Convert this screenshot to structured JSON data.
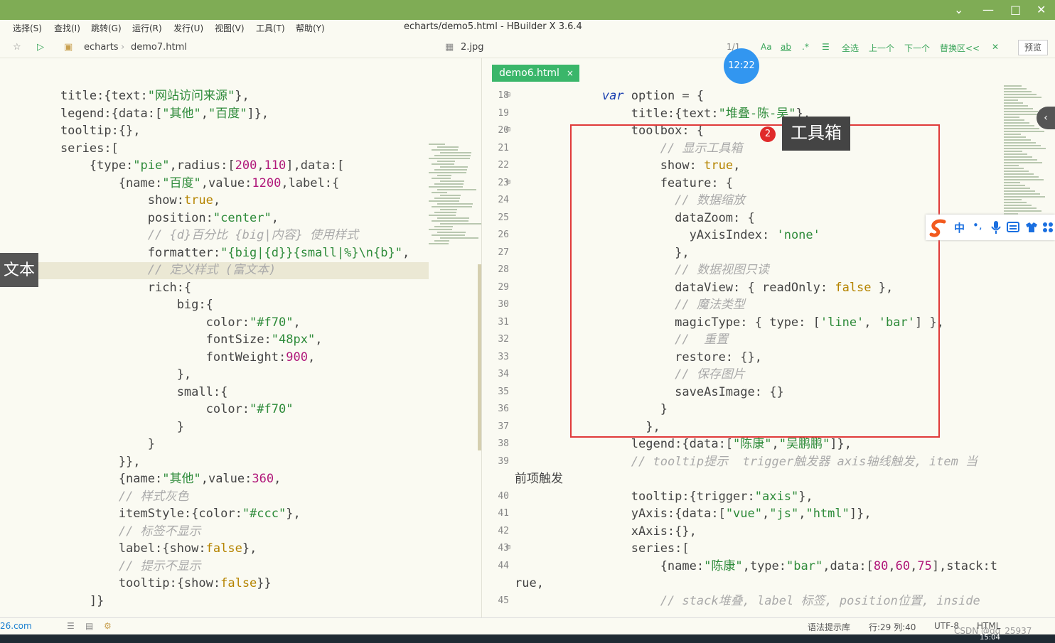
{
  "window": {
    "title": "echarts/demo5.html - HBuilder X 3.6.4"
  },
  "menu": [
    "选择(S)",
    "查找(I)",
    "跳转(G)",
    "运行(R)",
    "发行(U)",
    "视图(V)",
    "工具(T)",
    "帮助(Y)"
  ],
  "toolbar": {
    "breadcrumb": [
      "echarts",
      "demo7.html"
    ],
    "image_file": "2.jpg",
    "find_count": "1/1",
    "match_case": "Aa",
    "whole_word": "ab",
    "select_all": "全选",
    "prev": "上一个",
    "next": "下一个",
    "replace": "替换区<<",
    "preview": "预览"
  },
  "clock": "12:22",
  "tab": {
    "label": "demo6.html",
    "close": "×"
  },
  "annotation": {
    "badge": "2",
    "label": "工具箱",
    "left_tooltip": "文本"
  },
  "left_code": [
    "    title:{text:\"网站访问来源\"},",
    "    legend:{data:[\"其他\",\"百度\"]},",
    "    tooltip:{},",
    "    series:[",
    "        {type:\"pie\",radius:[200,110],data:[",
    "            {name:\"百度\",value:1200,label:{",
    "                show:true,",
    "                position:\"center\",",
    "                // {d}百分比 {big|内容} 使用样式",
    "                formatter:\"{big|{d}}{small|%}\\n{b}\",",
    "                // 定义样式 (富文本)",
    "                rich:{",
    "                    big:{",
    "                        color:\"#f70\",",
    "                        fontSize:\"48px\",",
    "                        fontWeight:900,",
    "                    },",
    "                    small:{",
    "                        color:\"#f70\"",
    "                    }",
    "                }",
    "            }},",
    "            {name:\"其他\",value:360,",
    "            // 样式灰色",
    "            itemStyle:{color:\"#ccc\"},",
    "            // 标签不显示",
    "            label:{show:false},",
    "            // 提示不显示",
    "            tooltip:{show:false}}",
    "        ]}"
  ],
  "right_code": [
    {
      "n": "18",
      "t": "            var option = {"
    },
    {
      "n": "19",
      "t": "                title:{text:\"堆叠-陈-吴\"},"
    },
    {
      "n": "20",
      "t": "                toolbox: {"
    },
    {
      "n": "21",
      "t": "                    // 显示工具箱"
    },
    {
      "n": "22",
      "t": "                    show: true,"
    },
    {
      "n": "23",
      "t": "                    feature: {"
    },
    {
      "n": "24",
      "t": "                      // 数据缩放"
    },
    {
      "n": "25",
      "t": "                      dataZoom: {"
    },
    {
      "n": "26",
      "t": "                        yAxisIndex: 'none'"
    },
    {
      "n": "27",
      "t": "                      },"
    },
    {
      "n": "28",
      "t": "                      // 数据视图只读"
    },
    {
      "n": "29",
      "t": "                      dataView: { readOnly: false },"
    },
    {
      "n": "30",
      "t": "                      // 魔法类型"
    },
    {
      "n": "31",
      "t": "                      magicType: { type: ['line', 'bar'] },"
    },
    {
      "n": "32",
      "t": "                      //  重置"
    },
    {
      "n": "33",
      "t": "                      restore: {},"
    },
    {
      "n": "34",
      "t": "                      // 保存图片"
    },
    {
      "n": "35",
      "t": "                      saveAsImage: {}"
    },
    {
      "n": "36",
      "t": "                    }"
    },
    {
      "n": "37",
      "t": "                  },"
    },
    {
      "n": "38",
      "t": "                legend:{data:[\"陈康\",\"吴鹏鹏\"]},"
    },
    {
      "n": "39",
      "t": "                // tooltip提示  trigger触发器 axis轴线触发, item 当"
    },
    {
      "n": "",
      "t": "前项触发"
    },
    {
      "n": "40",
      "t": "                tooltip:{trigger:\"axis\"},"
    },
    {
      "n": "41",
      "t": "                yAxis:{data:[\"vue\",\"js\",\"html\"]},"
    },
    {
      "n": "42",
      "t": "                xAxis:{},"
    },
    {
      "n": "43",
      "t": "                series:["
    },
    {
      "n": "44",
      "t": "                    {name:\"陈康\",type:\"bar\",data:[80,60,75],stack:t"
    },
    {
      "n": "",
      "t": "rue,"
    },
    {
      "n": "45",
      "t": "                    // stack堆叠, label 标签, position位置, inside"
    }
  ],
  "status": {
    "site": "26.com",
    "syntax": "语法提示库",
    "position": "行:29 列:40",
    "encoding": "UTF-8",
    "lang": "HTML",
    "watermark": "CSDN @qq_25937",
    "time": "15:04"
  },
  "ime": {
    "mode": "中",
    "punct": "•,"
  },
  "colors": {
    "accent": "#3ab66a",
    "title_bar": "#7fac55",
    "annotation_box": "#e03a3a"
  }
}
